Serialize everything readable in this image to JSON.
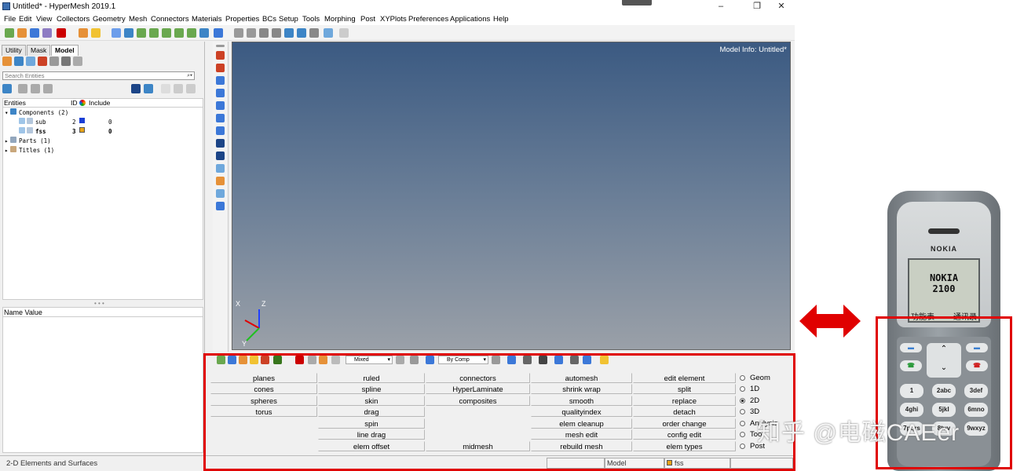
{
  "window": {
    "title": "Untitled* - HyperMesh 2019.1"
  },
  "menubar": [
    "File",
    "Edit",
    "View",
    "Collectors",
    "Geometry",
    "Mesh",
    "Connectors",
    "Materials",
    "Properties",
    "BCs",
    "Setup",
    "Tools",
    "Morphing",
    "Post",
    "XYPlots",
    "Preferences",
    "Applications",
    "Help"
  ],
  "left_panel": {
    "tabs": [
      "Utility",
      "Mask",
      "Model"
    ],
    "active_tab": "Model",
    "search_placeholder": "Search Entities",
    "columns": {
      "entities": "Entities",
      "id": "ID",
      "include": "Include"
    },
    "tree": {
      "components": "Components (2)",
      "sub": {
        "name": "sub",
        "id": "2",
        "include": "0",
        "color": "#1a3fd6"
      },
      "fss": {
        "name": "fss",
        "id": "3",
        "include": "0",
        "color": "#e8a317"
      },
      "parts": "Parts (1)",
      "titles": "Titles (1)"
    },
    "name_value_header": "Name Value"
  },
  "viewport": {
    "model_info": "Model Info: Untitled*",
    "triad": {
      "x": "X",
      "y": "Y",
      "z": "Z"
    }
  },
  "panel_toolbar": {
    "mixed": "Mixed",
    "by_comp": "By Comp"
  },
  "main_menu": {
    "col1": [
      "planes",
      "cones",
      "spheres",
      "torus"
    ],
    "col2": [
      "ruled",
      "spline",
      "skin",
      "drag",
      "spin",
      "line drag",
      "elem offset"
    ],
    "col3": [
      "connectors",
      "HyperLaminate",
      "composites",
      "midmesh"
    ],
    "col4": [
      "automesh",
      "shrink wrap",
      "smooth",
      "qualityindex",
      "elem cleanup",
      "mesh edit",
      "rebuild mesh"
    ],
    "col5": [
      "edit element",
      "split",
      "replace",
      "detach",
      "order change",
      "config edit",
      "elem types"
    ],
    "radios": [
      "Geom",
      "1D",
      "2D",
      "3D",
      "Analysis",
      "Tool",
      "Post"
    ],
    "selected_radio": "2D"
  },
  "statusbar": {
    "text": "2-D Elements and Surfaces",
    "model_field": "Model",
    "component_field": "fss"
  },
  "phone": {
    "brand": "NOKIA",
    "screen_line1": "NOKIA",
    "screen_line2": "2100",
    "softkey_left": "功能表",
    "softkey_right": "通讯录",
    "keys": [
      "1",
      "2abc",
      "3def",
      "4ghi",
      "5jkl",
      "6mno",
      "7pqrs",
      "8tuv",
      "9wxyz"
    ]
  },
  "watermark": "知乎 @电磁CAEer",
  "colors": {
    "highlight_box": "#e00000",
    "arrow": "#e00000",
    "viewport_top": "#3b5a82",
    "viewport_bottom": "#9aa0a8"
  }
}
